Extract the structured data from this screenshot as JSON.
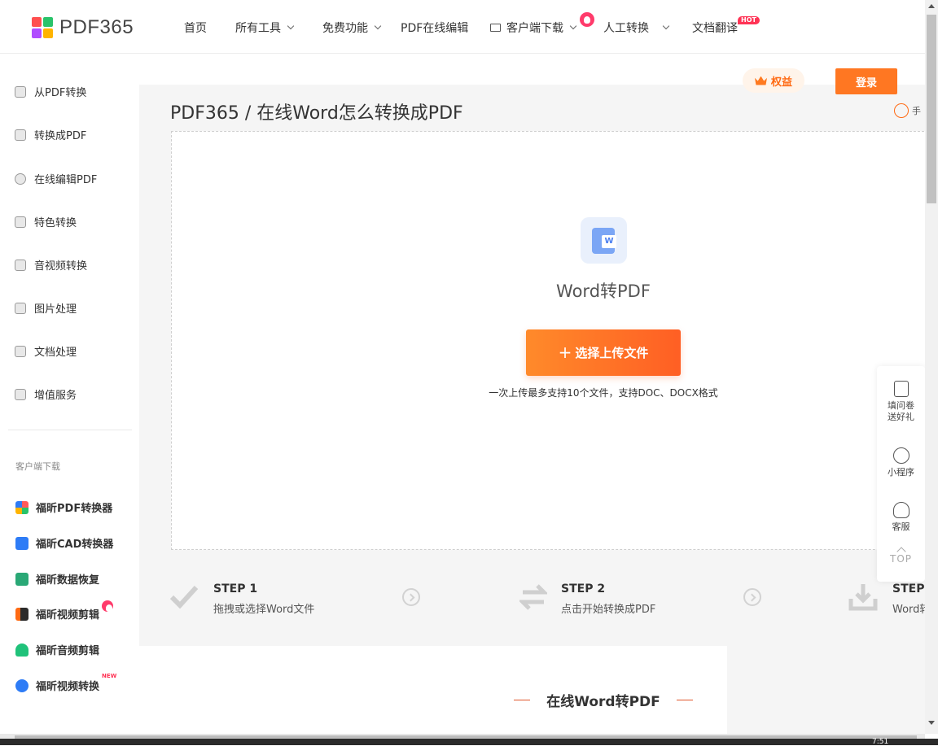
{
  "header": {
    "logo_text": "PDF365",
    "nav": [
      {
        "label": "首页",
        "dropdown": false
      },
      {
        "label": "所有工具",
        "dropdown": true
      },
      {
        "label": "免费功能",
        "dropdown": true
      },
      {
        "label": "PDF在线编辑",
        "dropdown": false
      },
      {
        "label": "客户端下载",
        "dropdown": true
      },
      {
        "label": "人工转换",
        "dropdown": true
      },
      {
        "label": "文档翻译",
        "dropdown": false
      }
    ],
    "hot_badge": "HOT",
    "benefits_label": "权益",
    "login_label": "登录"
  },
  "sidebar": {
    "items": [
      {
        "label": "从PDF转换",
        "icon": "pdf-convert-icon"
      },
      {
        "label": "转换成PDF",
        "icon": "to-pdf-icon"
      },
      {
        "label": "在线编辑PDF",
        "icon": "edit-icon"
      },
      {
        "label": "特色转换",
        "icon": "star-icon"
      },
      {
        "label": "音视频转换",
        "icon": "video-icon"
      },
      {
        "label": "图片处理",
        "icon": "image-icon"
      },
      {
        "label": "文档处理",
        "icon": "document-icon"
      },
      {
        "label": "增值服务",
        "icon": "service-icon"
      }
    ],
    "download_caption": "客户端下载",
    "downloads": [
      {
        "label": "福昕PDF转换器",
        "color": "#ff5a5a"
      },
      {
        "label": "福昕CAD转换器",
        "color": "#2e7cf6"
      },
      {
        "label": "福昕数据恢复",
        "color": "#2aa876"
      },
      {
        "label": "福昕视频剪辑",
        "color": "#ff6a13"
      },
      {
        "label": "福昕音频剪辑",
        "color": "#20c27a"
      },
      {
        "label": "福昕视频转换",
        "color": "#2e7cf6"
      }
    ],
    "new_badge": "NEW"
  },
  "main": {
    "breadcrumb": "PDF365 / 在线Word怎么转换成PDF",
    "phone_link": "手",
    "tool_title": "Word转PDF",
    "upload_button": "选择上传文件",
    "upload_plus": "+",
    "upload_hint": "一次上传最多支持10个文件，支持DOC、DOCX格式",
    "steps": [
      {
        "title": "STEP 1",
        "desc": "拖拽或选择Word文件"
      },
      {
        "title": "STEP 2",
        "desc": "点击开始转换成PDF"
      },
      {
        "title": "STEP",
        "desc": "Word转"
      }
    ],
    "section_title": "在线Word转PDF"
  },
  "float_bar": {
    "survey": "填问卷\n送好礼",
    "mini_program": "小程序",
    "service": "客服",
    "top": "TOP"
  },
  "taskbar": {
    "clock": "7:51"
  }
}
